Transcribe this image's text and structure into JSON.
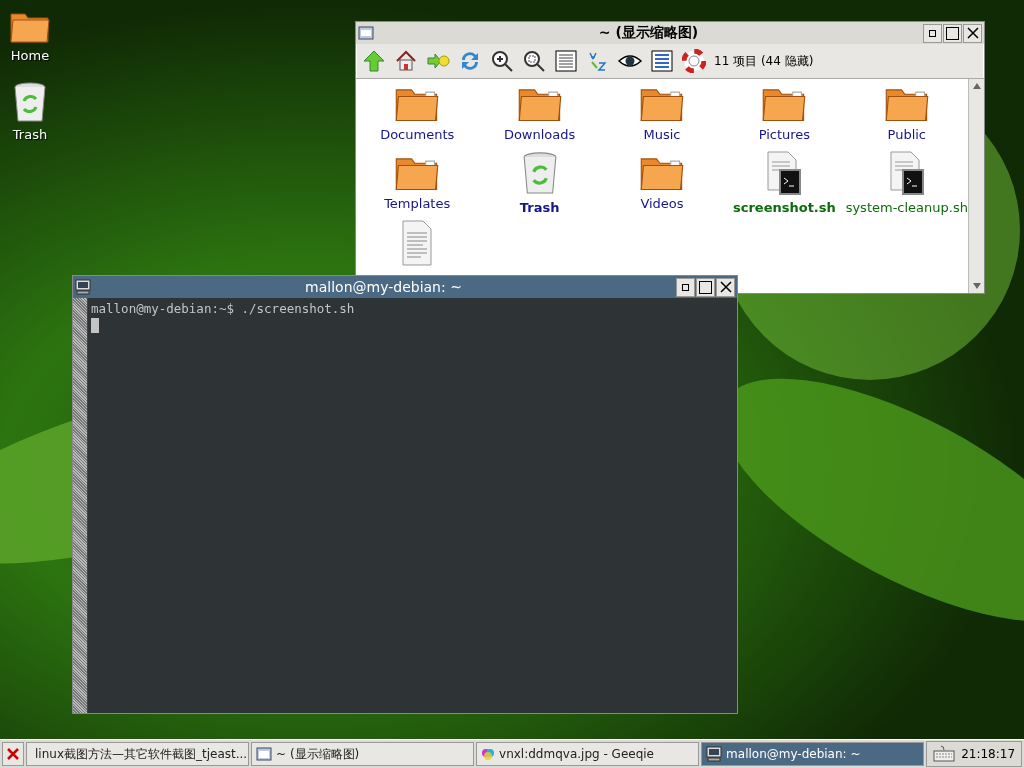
{
  "desktop": {
    "icons": [
      {
        "kind": "folder",
        "label": "Home"
      },
      {
        "kind": "trash",
        "label": "Trash"
      }
    ]
  },
  "file_manager": {
    "title": "~ (显示缩略图)",
    "status": "11 项目 (44 隐藏)",
    "files": [
      {
        "kind": "folder",
        "label": "Documents",
        "bold": false
      },
      {
        "kind": "folder",
        "label": "Downloads",
        "bold": false
      },
      {
        "kind": "folder",
        "label": "Music",
        "bold": false
      },
      {
        "kind": "folder",
        "label": "Pictures",
        "bold": false
      },
      {
        "kind": "folder",
        "label": "Public",
        "bold": false
      },
      {
        "kind": "folder",
        "label": "Templates",
        "bold": false
      },
      {
        "kind": "trash",
        "label": "Trash",
        "bold": true
      },
      {
        "kind": "folder",
        "label": "Videos",
        "bold": false
      },
      {
        "kind": "script",
        "label": "screenshot.sh",
        "bold": true
      },
      {
        "kind": "script",
        "label": "system-cleanup.sh",
        "bold": false
      },
      {
        "kind": "text"
      }
    ]
  },
  "terminal": {
    "title": "mallon@my-debian: ~",
    "lines": [
      "mallon@my-debian:~$ ./screenshot.sh"
    ]
  },
  "taskbar": {
    "items": [
      {
        "kind": "browser",
        "label": "linux截图方法—其它软件截图_tjeast...",
        "selected": false
      },
      {
        "kind": "files",
        "label": "~ (显示缩略图)",
        "selected": false
      },
      {
        "kind": "viewer",
        "label": "vnxl:ddmqva.jpg - Geeqie",
        "selected": false
      },
      {
        "kind": "terminal",
        "label": "mallon@my-debian: ~",
        "selected": true
      }
    ],
    "clock": "21:18:17"
  }
}
